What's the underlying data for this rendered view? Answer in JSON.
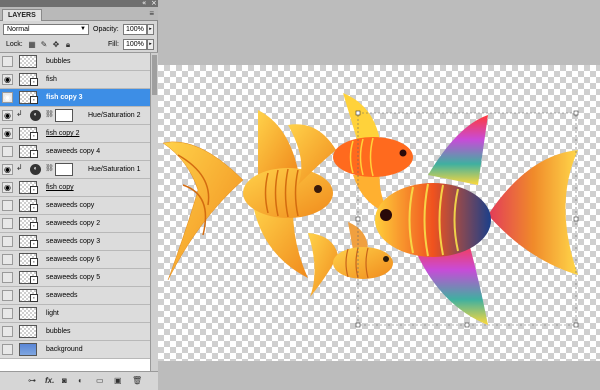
{
  "panel": {
    "tab": "LAYERS",
    "blend_mode": "Normal",
    "opacity_label": "Opacity:",
    "opacity_value": "100%",
    "lock_label": "Lock:",
    "fill_label": "Fill:",
    "fill_value": "100%"
  },
  "layers": [
    {
      "name": "bubbles",
      "visible": false,
      "kind": "pixel"
    },
    {
      "name": "fish",
      "visible": true,
      "kind": "smart"
    },
    {
      "name": "fish copy 3",
      "visible": true,
      "kind": "smart",
      "selected": true
    },
    {
      "name": "Hue/Saturation 2",
      "visible": true,
      "kind": "adjustment"
    },
    {
      "name": "fish copy 2",
      "visible": true,
      "kind": "smart"
    },
    {
      "name": "seaweeds copy 4",
      "visible": false,
      "kind": "smart"
    },
    {
      "name": "Hue/Saturation 1",
      "visible": true,
      "kind": "adjustment"
    },
    {
      "name": "fish copy",
      "visible": true,
      "kind": "smart"
    },
    {
      "name": "seaweeds copy",
      "visible": false,
      "kind": "smart"
    },
    {
      "name": "seaweeds copy 2",
      "visible": false,
      "kind": "smart"
    },
    {
      "name": "seaweeds copy 3",
      "visible": false,
      "kind": "smart"
    },
    {
      "name": "seaweeds copy 6",
      "visible": false,
      "kind": "smart"
    },
    {
      "name": "seaweeds copy 5",
      "visible": false,
      "kind": "smart"
    },
    {
      "name": "seaweeds",
      "visible": false,
      "kind": "smart"
    },
    {
      "name": "light",
      "visible": false,
      "kind": "pixel"
    },
    {
      "name": "bubbles",
      "visible": false,
      "kind": "pixel"
    },
    {
      "name": "background",
      "visible": false,
      "kind": "fill"
    }
  ],
  "colors": {
    "selection": "#3d8ee6",
    "fish_orange": "#f6a32a",
    "fish_red": "#e8382a",
    "background_thumb": "#7fa6e0"
  },
  "icons": {
    "bottom": [
      "link-layers-icon",
      "fx-icon",
      "add-mask-icon",
      "adjustment-layer-icon",
      "new-group-icon",
      "new-layer-icon",
      "trash-icon"
    ]
  }
}
